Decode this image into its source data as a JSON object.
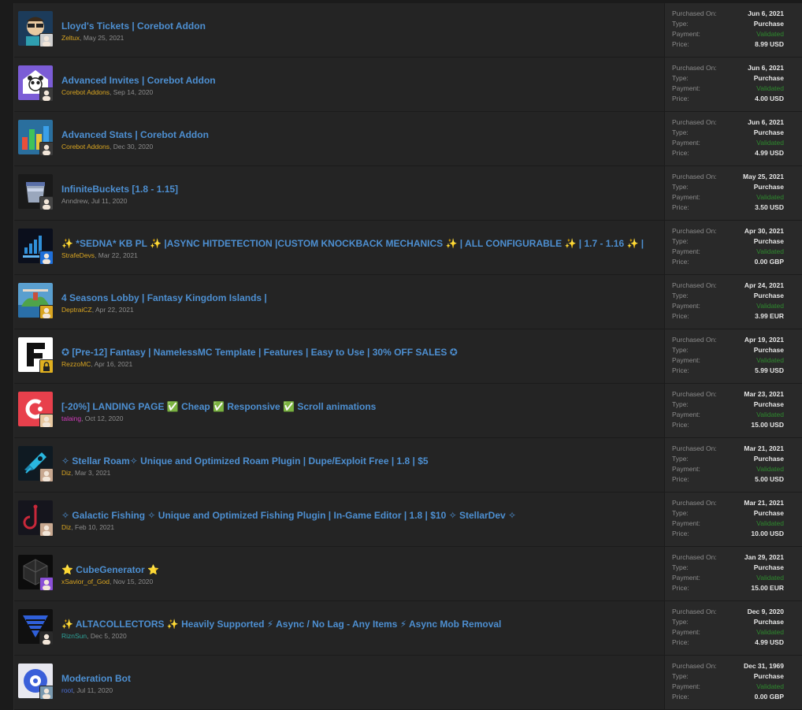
{
  "colors": {
    "title": "#4d8fd1",
    "validated": "#2e8b2e",
    "author_gold": "#d9a521",
    "author_teal": "#2ea39a",
    "author_magenta": "#d23cbd",
    "author_blue": "#4a6fd6"
  },
  "labels": {
    "purchased_on": "Purchased On:",
    "type": "Type:",
    "payment": "Payment:",
    "price": "Price:"
  },
  "resources": [
    {
      "title": "Lloyd's Tickets | Corebot Addon",
      "author": "Zeltux",
      "date": "May 25, 2021",
      "author_color": "#d9a521",
      "purchased_on": "Jun 6, 2021",
      "type": "Purchase",
      "payment": "Validated",
      "price": "8.99 USD",
      "icon": "cartoon-avatar-icon",
      "mini": "user-avatar-icon",
      "bg": "#1c3b5a",
      "mini_bg": "#cfcfcf"
    },
    {
      "title": "Advanced Invites | Corebot Addon",
      "author": "Corebot Addons",
      "date": "Sep 14, 2020",
      "author_color": "#d9a521",
      "purchased_on": "Jun 6, 2021",
      "type": "Purchase",
      "payment": "Validated",
      "price": "4.00 USD",
      "icon": "panda-envelope-icon",
      "mini": "user-avatar-icon",
      "bg": "#7b5cd6",
      "mini_bg": "#3a3a3a"
    },
    {
      "title": "Advanced Stats | Corebot Addon",
      "author": "Corebot Addons",
      "date": "Dec 30, 2020",
      "author_color": "#d9a521",
      "purchased_on": "Jun 6, 2021",
      "type": "Purchase",
      "payment": "Validated",
      "price": "4.99 USD",
      "icon": "bar-stats-icon",
      "mini": "user-avatar-icon",
      "bg": "#2a6f9e",
      "mini_bg": "#3a3a3a"
    },
    {
      "title": "InfiniteBuckets [1.8 - 1.15]",
      "author": "Anndrew",
      "date": "Jul 11, 2020",
      "author_color": "#8c8c8c",
      "purchased_on": "May 25, 2021",
      "type": "Purchase",
      "payment": "Validated",
      "price": "3.50 USD",
      "icon": "bucket-icon",
      "mini": "user-avatar-icon",
      "bg": "#1a1a1a",
      "mini_bg": "#444444"
    },
    {
      "title": "✨ *SEDNA* KB PL ✨ |ASYNC HITDETECTION |CUSTOM KNOCKBACK MECHANICS ✨ | ALL CONFIGURABLE ✨ | 1.7 - 1.16 ✨ |",
      "author": "StrafeDevs",
      "date": "Mar 22, 2021",
      "author_color": "#d9a521",
      "purchased_on": "Apr 30, 2021",
      "type": "Purchase",
      "payment": "Validated",
      "price": "0.00 GBP",
      "icon": "signal-bars-icon",
      "mini": "user-avatar-icon",
      "bg": "#0b0f1c",
      "mini_bg": "#1e6fd9"
    },
    {
      "title": "4 Seasons Lobby | Fantasy Kingdom Islands |",
      "author": "DeptraiCZ",
      "date": "Apr 22, 2021",
      "author_color": "#d9a521",
      "purchased_on": "Apr 24, 2021",
      "type": "Purchase",
      "payment": "Validated",
      "price": "3.99 EUR",
      "icon": "island-landscape-icon",
      "mini": "user-avatar-icon",
      "bg": "#5a9fcf",
      "mini_bg": "#d9a521"
    },
    {
      "title": "✪ [Pre-12] Fantasy | NamelessMC Template | Features | Easy to Use | 30% OFF SALES ✪",
      "author": "RezzoMC",
      "date": "Apr 16, 2021",
      "author_color": "#d9a521",
      "purchased_on": "Apr 19, 2021",
      "type": "Purchase",
      "payment": "Validated",
      "price": "5.99 USD",
      "icon": "letter-f-icon",
      "mini": "lock-icon",
      "bg": "#ffffff",
      "mini_bg": "#e0b020"
    },
    {
      "title": "[-20%] LANDING PAGE ✅ Cheap ✅ Responsive ✅ Scroll animations",
      "author": "talaing",
      "date": "Oct 12, 2020",
      "author_color": "#d23cbd",
      "purchased_on": "Mar 23, 2021",
      "type": "Purchase",
      "payment": "Validated",
      "price": "15.00 USD",
      "icon": "letter-c-icon",
      "mini": "user-avatar-icon",
      "bg": "#e8404c",
      "mini_bg": "#e8c8a0"
    },
    {
      "title": "✧ Stellar Roam✧ Unique and Optimized Roam Plugin | Dupe/Exploit Free | 1.8 | $5",
      "author": "Diz",
      "date": "Mar 3, 2021",
      "author_color": "#d9a521",
      "purchased_on": "Mar 21, 2021",
      "type": "Purchase",
      "payment": "Validated",
      "price": "5.00 USD",
      "icon": "rocket-icon",
      "mini": "user-avatar-icon",
      "bg": "#0f1a22",
      "mini_bg": "#c8a890"
    },
    {
      "title": "✧ Galactic Fishing ✧ Unique and Optimized Fishing Plugin | In-Game Editor | 1.8 | $10 ✧ StellarDev ✧",
      "author": "Diz",
      "date": "Feb 10, 2021",
      "author_color": "#d9a521",
      "purchased_on": "Mar 21, 2021",
      "type": "Purchase",
      "payment": "Validated",
      "price": "10.00 USD",
      "icon": "fishing-hook-icon",
      "mini": "user-avatar-icon",
      "bg": "#15151d",
      "mini_bg": "#c8a890"
    },
    {
      "title": "⭐ CubeGenerator ⭐",
      "author": "xSavior_of_God",
      "date": "Nov 15, 2020",
      "author_color": "#d9a521",
      "purchased_on": "Jan 29, 2021",
      "type": "Purchase",
      "payment": "Validated",
      "price": "15.00 EUR",
      "icon": "dark-cube-icon",
      "mini": "user-avatar-icon",
      "bg": "#0c0c0c",
      "mini_bg": "#8a4fd8"
    },
    {
      "title": "✨ ALTACOLLECTORS ✨ Heavily Supported ⚡ Async / No Lag - Any Items ⚡ Async Mob Removal",
      "author": "RiznSun",
      "date": "Dec 5, 2020",
      "author_color": "#2ea39a",
      "purchased_on": "Dec 9, 2020",
      "type": "Purchase",
      "payment": "Validated",
      "price": "4.99 USD",
      "icon": "funnel-icon",
      "mini": "user-avatar-icon",
      "bg": "#101010",
      "mini_bg": "#2a2a2a"
    },
    {
      "title": "Moderation Bot",
      "author": "root",
      "date": "Jul 11, 2020",
      "author_color": "#4a6fd6",
      "purchased_on": "Dec 31, 1969",
      "type": "Purchase",
      "payment": "Validated",
      "price": "0.00 GBP",
      "icon": "robot-logo-icon",
      "mini": "user-avatar-icon",
      "bg": "#e8e8f0",
      "mini_bg": "#7a9ab0"
    }
  ]
}
